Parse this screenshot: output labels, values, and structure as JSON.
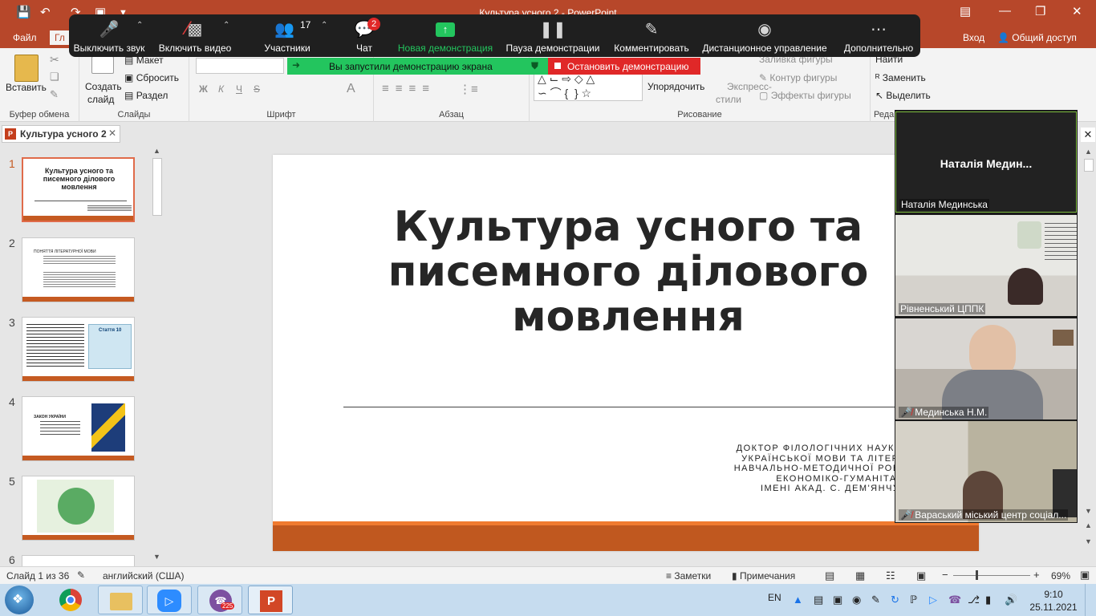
{
  "window": {
    "title": "Культура усного 2 - PowerPoint"
  },
  "ribbon_tabs": {
    "file": "Файл",
    "home_partial": "Гл",
    "signin": "Вход",
    "share": "Общий доступ"
  },
  "ribbon": {
    "paste": "Вставить",
    "clipboard_group": "Буфер обмена",
    "create_slide": "Создать",
    "create_slide2": "слайд",
    "layout": "Макет",
    "reset": "Сбросить",
    "section": "Раздел",
    "slides_group": "Слайды",
    "bold": "Ж",
    "italic": "К",
    "underline": "Ч",
    "strike": "S",
    "font_group": "Шрифт",
    "paragraph_group": "Абзац",
    "arrange": "Упорядочить",
    "quick_styles": "Экспресс-",
    "quick_styles2": "стили",
    "shape_fill": "Заливка фигуры",
    "shape_outline": "Контур фигуры",
    "shape_effects": "Эффекты фигуры",
    "drawing_group": "Рисование",
    "find": "Найти",
    "replace": "Заменить",
    "select": "Выделить",
    "editing_group_partial": "Реда"
  },
  "zoom": {
    "mute": "Выключить звук",
    "video": "Включить видео",
    "participants": "Участники",
    "participants_count": "17",
    "chat": "Чат",
    "chat_badge": "2",
    "new_share": "Новая демонстрация",
    "pause": "Пауза демонстрации",
    "annotate": "Комментировать",
    "remote": "Дистанционное управление",
    "more": "Дополнительно",
    "sharing_banner": "Вы запустили демонстрацию экрана",
    "stop_share": "Остановить демонстрацию",
    "colors": {
      "toolbar": "#1f1f1f",
      "green": "#23c55e",
      "red": "#e02828"
    }
  },
  "document_tab": "Культура усного 2",
  "thumbnails": [
    {
      "num": "1",
      "title": "Культура усного та писемного ділового мовлення"
    },
    {
      "num": "2",
      "title": "ПОНЯТТЯ ЛІТЕРАТУРНОЇ МОВИ"
    },
    {
      "num": "3",
      "title": "Стаття 10"
    },
    {
      "num": "4",
      "title": "ЗАКОН УКРАЇНИ"
    },
    {
      "num": "5",
      "title": ""
    },
    {
      "num": "6",
      "title": ""
    }
  ],
  "slide": {
    "title": "Культура усного та писемного ділового мовлення",
    "subtitle": [
      "ДОКТОР ФІЛОЛОГІЧНИХ НАУК, ПРОФЕСО",
      "УКРАЇНСЬКОЇ МОВИ ТА ЛІТЕРАТУРИ, ПР",
      "НАВЧАЛЬНО-МЕТОДИЧНОЇ РОБОТИ МІЖН",
      "ЕКОНОМІКО-ГУМАНІТАРНОГО УНІ",
      "ІМЕНІ АКАД.  С. ДЕМ'ЯНЧУКА  МЕДИН"
    ],
    "accent": "#c0581f"
  },
  "participants": [
    {
      "center_name": "Наталія  Медин...",
      "name": "Наталія Мединська",
      "muted": false
    },
    {
      "name": "Рівненський ЦППК",
      "muted": false
    },
    {
      "name": "Мединська Н.М.",
      "muted": true
    },
    {
      "name": "Вараський міський центр соціал...",
      "muted": true
    }
  ],
  "status": {
    "slide": "Слайд 1 из 36",
    "language": "английский (США)",
    "notes": "Заметки",
    "comments": "Примечания",
    "zoom": "69%"
  },
  "taskbar": {
    "lang": "EN",
    "time": "9:10",
    "date": "25.11.2021",
    "viber_badge": "225"
  }
}
